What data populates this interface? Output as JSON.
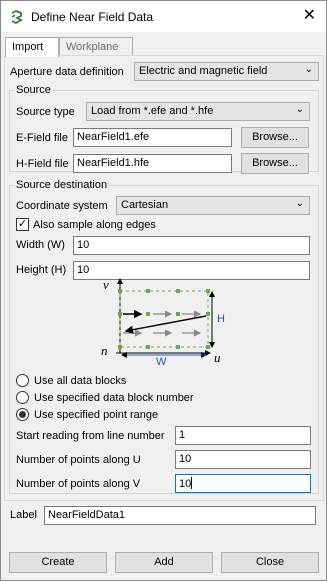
{
  "window": {
    "title": "Define Near Field Data",
    "close_glyph": "✕"
  },
  "tabs": [
    {
      "label": "Import",
      "active": true
    },
    {
      "label": "Workplane",
      "active": false
    }
  ],
  "aperture": {
    "label": "Aperture data definition",
    "value": "Electric and magnetic field"
  },
  "source": {
    "legend": "Source",
    "type_label": "Source type",
    "type_value": "Load from *.efe and *.hfe",
    "efield_label": "E-Field file",
    "efield_value": "NearField1.efe",
    "hfield_label": "H-Field file",
    "hfield_value": "NearField1.hfe",
    "browse_label": "Browse..."
  },
  "destination": {
    "legend": "Source destination",
    "coord_label": "Coordinate system",
    "coord_value": "Cartesian",
    "sample_edges_label": "Also sample along edges",
    "sample_edges_checked": true,
    "width_label": "Width (W)",
    "width_value": "10",
    "height_label": "Height (H)",
    "height_value": "10",
    "diagram": {
      "v": "v",
      "u": "u",
      "n": "n",
      "w": "W",
      "h": "H",
      "accent": "#1f5fa8",
      "point_color": "#6aa84f"
    },
    "radio_options": [
      {
        "label": "Use all data blocks",
        "selected": false
      },
      {
        "label": "Use specified data block number",
        "selected": false
      },
      {
        "label": "Use specified point range",
        "selected": true
      }
    ],
    "start_line_label": "Start reading from line number",
    "start_line_value": "1",
    "points_u_label": "Number of points along U",
    "points_u_value": "10",
    "points_v_label": "Number of points along V",
    "points_v_value": "10"
  },
  "label_field": {
    "label": "Label",
    "value": "NearFieldData1"
  },
  "footer": {
    "create": "Create",
    "add": "Add",
    "close": "Close"
  }
}
